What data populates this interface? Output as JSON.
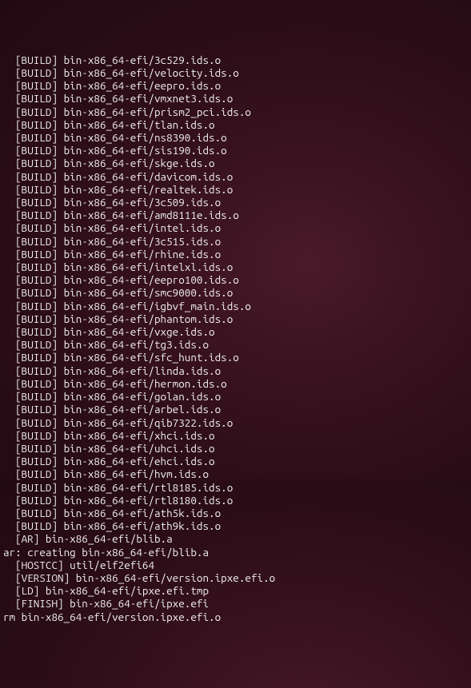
{
  "lines": [
    "  [BUILD] bin-x86_64-efi/3c529.ids.o",
    "  [BUILD] bin-x86_64-efi/velocity.ids.o",
    "  [BUILD] bin-x86_64-efi/eepro.ids.o",
    "  [BUILD] bin-x86_64-efi/vmxnet3.ids.o",
    "  [BUILD] bin-x86_64-efi/prism2_pci.ids.o",
    "  [BUILD] bin-x86_64-efi/tlan.ids.o",
    "  [BUILD] bin-x86_64-efi/ns8390.ids.o",
    "  [BUILD] bin-x86_64-efi/sis190.ids.o",
    "  [BUILD] bin-x86_64-efi/skge.ids.o",
    "  [BUILD] bin-x86_64-efi/davicom.ids.o",
    "  [BUILD] bin-x86_64-efi/realtek.ids.o",
    "  [BUILD] bin-x86_64-efi/3c509.ids.o",
    "  [BUILD] bin-x86_64-efi/amd8111e.ids.o",
    "  [BUILD] bin-x86_64-efi/intel.ids.o",
    "  [BUILD] bin-x86_64-efi/3c515.ids.o",
    "  [BUILD] bin-x86_64-efi/rhine.ids.o",
    "  [BUILD] bin-x86_64-efi/intelxl.ids.o",
    "  [BUILD] bin-x86_64-efi/eepro100.ids.o",
    "  [BUILD] bin-x86_64-efi/smc9000.ids.o",
    "  [BUILD] bin-x86_64-efi/igbvf_main.ids.o",
    "  [BUILD] bin-x86_64-efi/phantom.ids.o",
    "  [BUILD] bin-x86_64-efi/vxge.ids.o",
    "  [BUILD] bin-x86_64-efi/tg3.ids.o",
    "  [BUILD] bin-x86_64-efi/sfc_hunt.ids.o",
    "  [BUILD] bin-x86_64-efi/linda.ids.o",
    "  [BUILD] bin-x86_64-efi/hermon.ids.o",
    "  [BUILD] bin-x86_64-efi/golan.ids.o",
    "  [BUILD] bin-x86_64-efi/arbel.ids.o",
    "  [BUILD] bin-x86_64-efi/qib7322.ids.o",
    "  [BUILD] bin-x86_64-efi/xhci.ids.o",
    "  [BUILD] bin-x86_64-efi/uhci.ids.o",
    "  [BUILD] bin-x86_64-efi/ehci.ids.o",
    "  [BUILD] bin-x86_64-efi/hvm.ids.o",
    "  [BUILD] bin-x86_64-efi/rtl8185.ids.o",
    "  [BUILD] bin-x86_64-efi/rtl8180.ids.o",
    "  [BUILD] bin-x86_64-efi/ath5k.ids.o",
    "  [BUILD] bin-x86_64-efi/ath9k.ids.o",
    "  [AR] bin-x86_64-efi/blib.a",
    "ar: creating bin-x86_64-efi/blib.a",
    "  [HOSTCC] util/elf2efi64",
    "  [VERSION] bin-x86_64-efi/version.ipxe.efi.o",
    "  [LD] bin-x86_64-efi/ipxe.efi.tmp",
    "  [FINISH] bin-x86_64-efi/ipxe.efi",
    "rm bin-x86_64-efi/version.ipxe.efi.o"
  ]
}
